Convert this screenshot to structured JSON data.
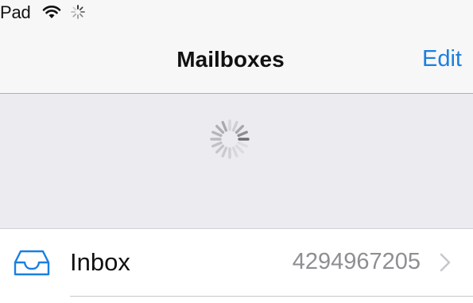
{
  "status_bar": {
    "carrier": "Pad"
  },
  "nav": {
    "title": "Mailboxes",
    "edit_label": "Edit"
  },
  "mailboxes": [
    {
      "label": "Inbox",
      "count": "4294967205",
      "icon": "inbox-tray-icon"
    }
  ],
  "colors": {
    "accent": "#1a7fe0",
    "count_text": "#8e8e93",
    "refresh_background": "#ececf0",
    "bar_background": "#f7f7f7"
  }
}
